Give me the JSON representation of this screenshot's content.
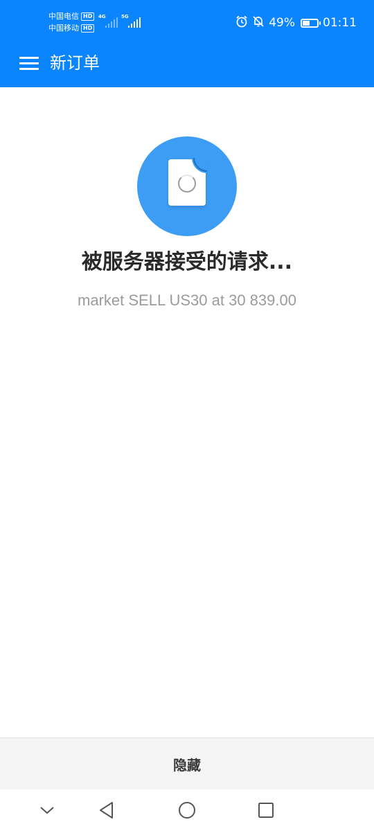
{
  "status_bar": {
    "carrier_1": "中国电信",
    "carrier_2": "中国移动",
    "hd_label": "HD",
    "network_1": "4G",
    "network_2": "5G",
    "battery_percent": "49%",
    "battery_level": 0.49,
    "time": "01:11",
    "icons": [
      "alarm-icon",
      "bell-off-icon",
      "battery-icon"
    ]
  },
  "app_bar": {
    "title": "新订单",
    "menu_icon": "menu-icon"
  },
  "main": {
    "status_title": "被服务器接受的请求...",
    "order_summary": "market SELL US30 at 30 839.00",
    "illustration_icon": "document-loading-icon",
    "accent_color": "#3d9df5"
  },
  "footer": {
    "hide_label": "隐藏"
  },
  "system_nav": {
    "buttons": [
      "collapse-icon",
      "back-icon",
      "home-icon",
      "recents-icon"
    ]
  },
  "colors": {
    "primary": "#0a84ff",
    "title_text": "#2a2a2a",
    "secondary_text": "#9b9b9b"
  }
}
